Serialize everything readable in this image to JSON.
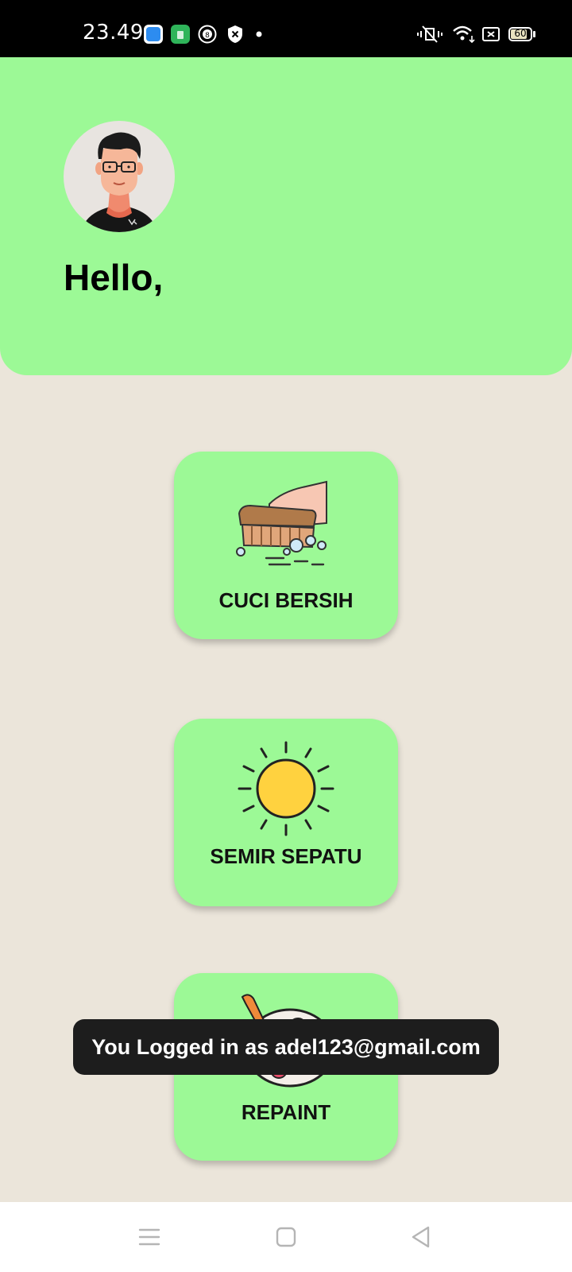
{
  "status_bar": {
    "time": "23.49",
    "battery": "60",
    "icons": [
      "app-icon-blue",
      "app-icon-green",
      "notification-8-icon",
      "shield-x-icon",
      "dot-icon",
      "vibrate-mute-icon",
      "wifi-icon",
      "sim-x-icon",
      "battery-icon"
    ]
  },
  "header": {
    "greeting": "Hello,"
  },
  "services": [
    {
      "label": "CUCI BERSIH",
      "icon": "scrub-brush-icon"
    },
    {
      "label": "SEMIR SEPATU",
      "icon": "sun-icon"
    },
    {
      "label": "REPAINT",
      "icon": "paint-palette-icon"
    }
  ],
  "toast": {
    "message": "You Logged in as adel123@gmail.com"
  },
  "nav": {
    "icons": [
      "menu-icon",
      "home-square-icon",
      "back-triangle-icon"
    ]
  },
  "colors": {
    "accent_green": "#9cf996",
    "background": "#ebe5da",
    "toast_bg": "#1d1d1d"
  }
}
